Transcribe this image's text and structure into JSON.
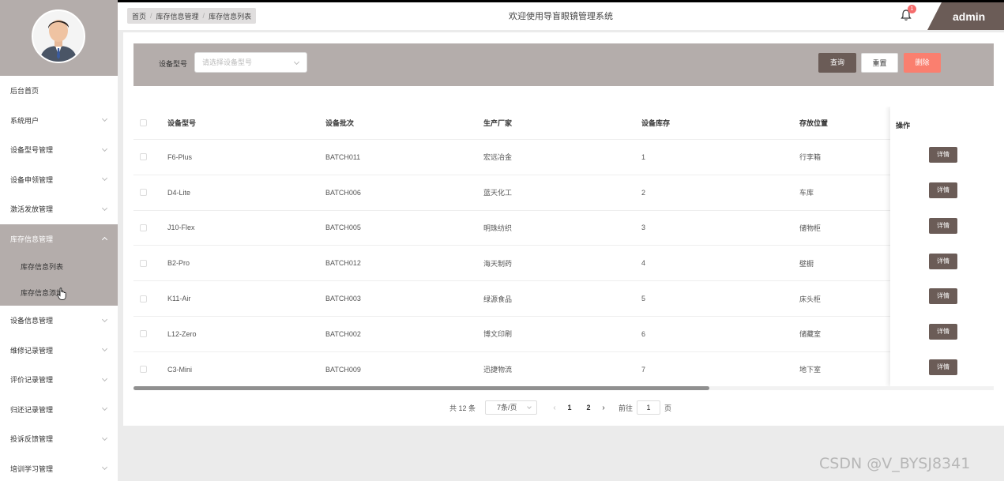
{
  "sidebar": {
    "items": [
      {
        "label": "后台首页",
        "chev": false
      },
      {
        "label": "系统用户",
        "chev": true
      },
      {
        "label": "设备型号管理",
        "chev": true
      },
      {
        "label": "设备申领管理",
        "chev": true
      },
      {
        "label": "激活发放管理",
        "chev": true
      },
      {
        "label": "库存信息管理",
        "chev": true,
        "active": true
      },
      {
        "label": "设备信息管理",
        "chev": true
      },
      {
        "label": "维修记录管理",
        "chev": true
      },
      {
        "label": "评价记录管理",
        "chev": true
      },
      {
        "label": "归还记录管理",
        "chev": true
      },
      {
        "label": "投诉反馈管理",
        "chev": true
      },
      {
        "label": "培训学习管理",
        "chev": true
      }
    ],
    "submenu": [
      "库存信息列表",
      "库存信息添加"
    ]
  },
  "header": {
    "breadcrumb": [
      "首页",
      "库存信息管理",
      "库存信息列表"
    ],
    "title": "欢迎使用导盲眼镜管理系统",
    "notification_count": "1",
    "user": "admin"
  },
  "search": {
    "label": "设备型号",
    "placeholder": "请选择设备型号",
    "query_label": "查询",
    "reset_label": "重置",
    "delete_label": "删除"
  },
  "table": {
    "columns": [
      "设备型号",
      "设备批次",
      "生产厂家",
      "设备库存",
      "存放位置"
    ],
    "op_header": "操作",
    "detail_label": "详情",
    "rows": [
      [
        "F6-Plus",
        "BATCH011",
        "宏远冶金",
        "1",
        "行李箱"
      ],
      [
        "D4-Lite",
        "BATCH006",
        "蓝天化工",
        "2",
        "车库"
      ],
      [
        "J10-Flex",
        "BATCH005",
        "明珠纺织",
        "3",
        "储物柜"
      ],
      [
        "B2-Pro",
        "BATCH012",
        "海天制药",
        "4",
        "壁橱"
      ],
      [
        "K11-Air",
        "BATCH003",
        "绿源食品",
        "5",
        "床头柜"
      ],
      [
        "L12-Zero",
        "BATCH002",
        "博文印刷",
        "6",
        "储藏室"
      ],
      [
        "C3-Mini",
        "BATCH009",
        "迅捷物流",
        "7",
        "地下室"
      ]
    ]
  },
  "pagination": {
    "total": "共 12 条",
    "page_size": "7条/页",
    "pages": [
      "1",
      "2"
    ],
    "goto_prefix": "前往",
    "goto_value": "1",
    "goto_suffix": "页"
  },
  "watermark": "CSDN @V_BYSJ8341",
  "colors": {
    "primary": "#6b5c57",
    "panel": "#b4adab",
    "danger": "#fa7f6f",
    "badge": "#f56c6c"
  }
}
